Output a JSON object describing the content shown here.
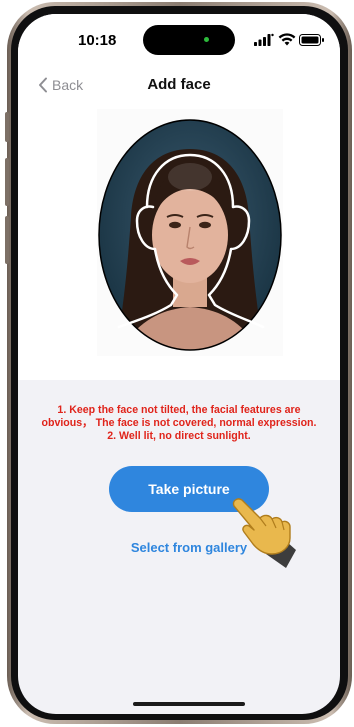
{
  "status_bar": {
    "time": "10:18"
  },
  "nav": {
    "back_label": "Back",
    "title": "Add face"
  },
  "instructions": {
    "line1": "1. Keep the face not tilted, the facial features are",
    "line2": "obvious， The face is not covered, normal expression.",
    "line3": "2. Well lit, no direct sunlight."
  },
  "actions": {
    "take_picture_label": "Take picture",
    "gallery_label": "Select from gallery"
  },
  "colors": {
    "accent": "#2f86de",
    "warning": "#e0241b",
    "background": "#f2f2f6"
  },
  "icons": {
    "back": "chevron-left-icon",
    "signal": "signal-icon",
    "wifi": "wifi-icon",
    "battery": "battery-icon",
    "pointer": "pointing-hand-icon"
  }
}
